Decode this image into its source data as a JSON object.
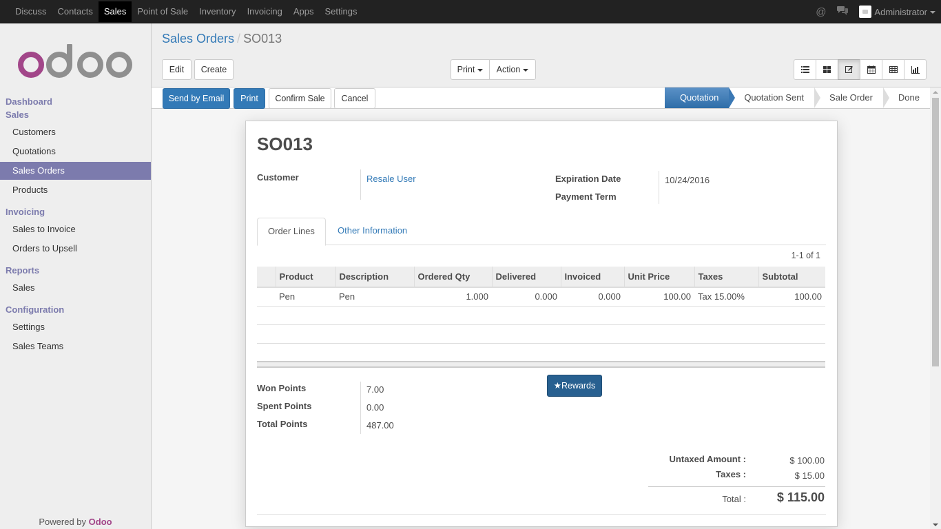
{
  "topbar": {
    "menu": [
      "Discuss",
      "Contacts",
      "Sales",
      "Point of Sale",
      "Inventory",
      "Invoicing",
      "Apps",
      "Settings"
    ],
    "active_menu": "Sales",
    "icons": [
      "at-icon",
      "chat-icon"
    ],
    "user": "Administrator"
  },
  "sidebar": {
    "brand": "odoo",
    "sections": [
      {
        "title": "Dashboard",
        "items": []
      },
      {
        "title": "Sales",
        "items": [
          "Customers",
          "Quotations",
          "Sales Orders",
          "Products"
        ]
      },
      {
        "title": "Invoicing",
        "items": [
          "Sales to Invoice",
          "Orders to Upsell"
        ]
      },
      {
        "title": "Reports",
        "items": [
          "Sales"
        ]
      },
      {
        "title": "Configuration",
        "items": [
          "Settings",
          "Sales Teams"
        ]
      }
    ],
    "active_item": "Sales Orders",
    "powered_prefix": "Powered by",
    "powered_brand": "Odoo",
    "brand_color": "#a24689",
    "accent_color": "#7c7bad"
  },
  "breadcrumb": {
    "parent": "Sales Orders",
    "separator": "/",
    "current": "SO013"
  },
  "toolbar": {
    "edit": "Edit",
    "create": "Create",
    "print": "Print",
    "action": "Action",
    "views": [
      "list-view-icon",
      "kanban-view-icon",
      "form-view-icon",
      "calendar-view-icon",
      "pivot-view-icon",
      "graph-view-icon"
    ],
    "active_view": "form-view-icon"
  },
  "statusbar": {
    "buttons": [
      "Send by Email",
      "Print",
      "Confirm Sale",
      "Cancel"
    ],
    "stages": [
      "Quotation",
      "Quotation Sent",
      "Sale Order",
      "Done"
    ],
    "active_stage": "Quotation"
  },
  "form": {
    "name": "SO013",
    "customer_label": "Customer",
    "customer": "Resale User",
    "expiration_label": "Expiration Date",
    "expiration": "10/24/2016",
    "payment_term_label": "Payment Term",
    "payment_term": "",
    "tabs": [
      "Order Lines",
      "Other Information"
    ],
    "active_tab": "Order Lines",
    "pager": "1-1 of 1",
    "columns": [
      "Product",
      "Description",
      "Ordered Qty",
      "Delivered",
      "Invoiced",
      "Unit Price",
      "Taxes",
      "Subtotal"
    ],
    "lines": [
      {
        "product": "Pen",
        "description": "Pen",
        "qty": "1.000",
        "delivered": "0.000",
        "invoiced": "0.000",
        "unit_price": "100.00",
        "taxes": "Tax 15.00%",
        "subtotal": "100.00"
      }
    ],
    "points": {
      "won_label": "Won Points",
      "won": "7.00",
      "spent_label": "Spent Points",
      "spent": "0.00",
      "total_label": "Total Points",
      "total": "487.00"
    },
    "rewards_button": "Rewards",
    "totals": {
      "untaxed_label": "Untaxed Amount :",
      "untaxed": "$ 100.00",
      "taxes_label": "Taxes :",
      "taxes": "$ 15.00",
      "total_label": "Total :",
      "total": "$ 115.00"
    }
  }
}
